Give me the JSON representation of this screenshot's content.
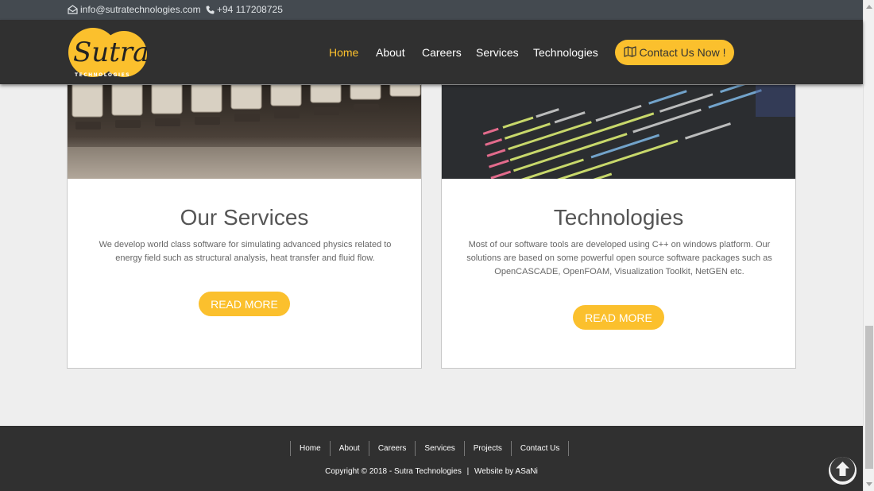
{
  "topbar": {
    "email": "info@sutratechnologies.com",
    "phone": "+94 117208725"
  },
  "logo": {
    "wordmark": "Sutra",
    "tagline": "TECHNOLOGIES"
  },
  "nav": {
    "items": [
      {
        "label": "Home",
        "active": true
      },
      {
        "label": "About"
      },
      {
        "label": "Careers"
      },
      {
        "label": "Services"
      },
      {
        "label": "Technologies"
      }
    ],
    "contact_label": "Contact Us Now !"
  },
  "cards": [
    {
      "title": "Our Services",
      "text": "We develop world class software for simulating advanced physics related to energy field such as structural analysis, heat transfer and fluid flow.",
      "button": "READ MORE"
    },
    {
      "title": "Technologies",
      "text": "Most of our software tools are developed using C++ on windows platform. Our solutions are based on some powerful open source software packages such as OpenCASCADE, OpenFOAM, Visualization Toolkit, NetGEN etc.",
      "button": "READ MORE"
    }
  ],
  "footer": {
    "links": [
      "Home",
      "About",
      "Careers",
      "Services",
      "Projects",
      "Contact Us"
    ],
    "copyright": "Copyright © 2018 - Sutra Technologies",
    "separator": "|",
    "credit": "Website by ASaNi"
  },
  "colors": {
    "accent": "#fbc02d",
    "nav_bg": "#303030",
    "topbar_bg": "#444a50"
  },
  "icons": {
    "email": "envelope-icon",
    "phone": "phone-icon",
    "contact": "map-icon",
    "to_top": "arrow-up-circle-icon"
  }
}
